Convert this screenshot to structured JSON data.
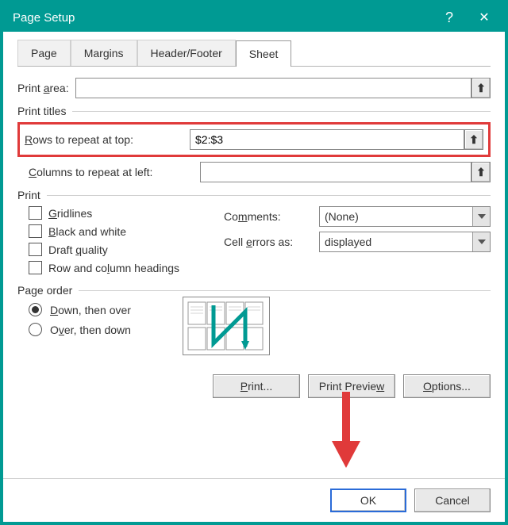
{
  "titlebar": {
    "title": "Page Setup",
    "help": "?",
    "close": "✕"
  },
  "tabs": {
    "page": "Page",
    "margins": "Margins",
    "header_footer": "Header/Footer",
    "sheet": "Sheet"
  },
  "print_area": {
    "label_pre": "Print ",
    "label_u": "a",
    "label_post": "rea:",
    "value": ""
  },
  "print_titles": {
    "legend": "Print titles",
    "rows": {
      "u": "R",
      "label": "ows to repeat at top:",
      "value": "$2:$3"
    },
    "cols": {
      "u": "C",
      "label": "olumns to repeat at left:",
      "value": ""
    }
  },
  "print": {
    "legend": "Print",
    "gridlines": {
      "u": "G",
      "label": "ridlines"
    },
    "bw": {
      "u": "B",
      "label": "lack and white"
    },
    "draft": {
      "pre": "Draft ",
      "u": "q",
      "post": "uality"
    },
    "rowcol": {
      "pre": "Row and co",
      "u": "l",
      "post": "umn headings"
    },
    "comments": {
      "label_pre": "Co",
      "label_u": "m",
      "label_post": "ments:",
      "value": "(None)"
    },
    "errors": {
      "label_pre": "Cell ",
      "label_u": "e",
      "label_post": "rrors as:",
      "value": "displayed"
    }
  },
  "page_order": {
    "legend": "Page order",
    "down_over": {
      "u": "D",
      "label": "own, then over"
    },
    "over_down": {
      "pre": "O",
      "u": "v",
      "post": "er, then down"
    }
  },
  "buttons": {
    "print": {
      "u": "P",
      "label": "rint..."
    },
    "preview": {
      "pre": "Print Previe",
      "u": "w"
    },
    "options": {
      "u": "O",
      "label": "ptions..."
    }
  },
  "footer": {
    "ok": "OK",
    "cancel": "Cancel"
  },
  "colors": {
    "accent": "#009a93",
    "highlight": "#e03a3a",
    "primary_border": "#2a6bd8"
  }
}
